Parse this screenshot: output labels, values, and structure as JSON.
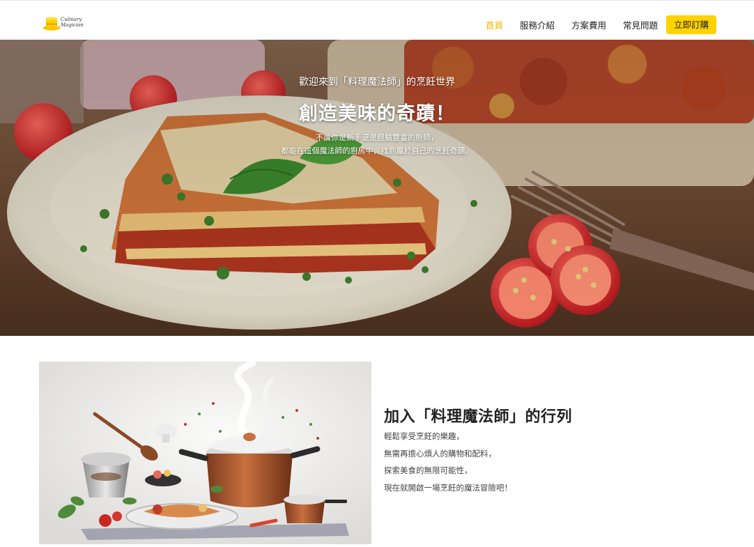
{
  "brand": {
    "line1": "Culinary",
    "line2": "Magician",
    "logo_icon": "top-hat-icon"
  },
  "nav": {
    "items": [
      {
        "label": "首頁",
        "active": true
      },
      {
        "label": "服務介紹",
        "active": false
      },
      {
        "label": "方案費用",
        "active": false
      },
      {
        "label": "常見問題",
        "active": false
      }
    ],
    "cta_label": "立即訂購"
  },
  "hero": {
    "welcome": "歡迎來到「料理魔法師」的烹飪世界",
    "title": "創造美味的奇蹟！",
    "desc_line1": "不論你是新手還是經驗豐富的廚師，",
    "desc_line2": "都能在這個魔法師的廚房中，找到屬於自己的烹飪奇蹟。",
    "image": "lasagna-plate-photo"
  },
  "join": {
    "title": "加入「料理魔法師」的行列",
    "lines": [
      "輕鬆享受烹飪的樂趣，",
      "無需再擔心煩人的購物和配料，",
      "探索美食的無限可能性，",
      "現在就開啟一場烹飪的魔法冒險吧！"
    ],
    "image": "cooking-pot-illustration"
  },
  "colors": {
    "accent": "#ffd200",
    "active_nav": "#f2b400"
  }
}
